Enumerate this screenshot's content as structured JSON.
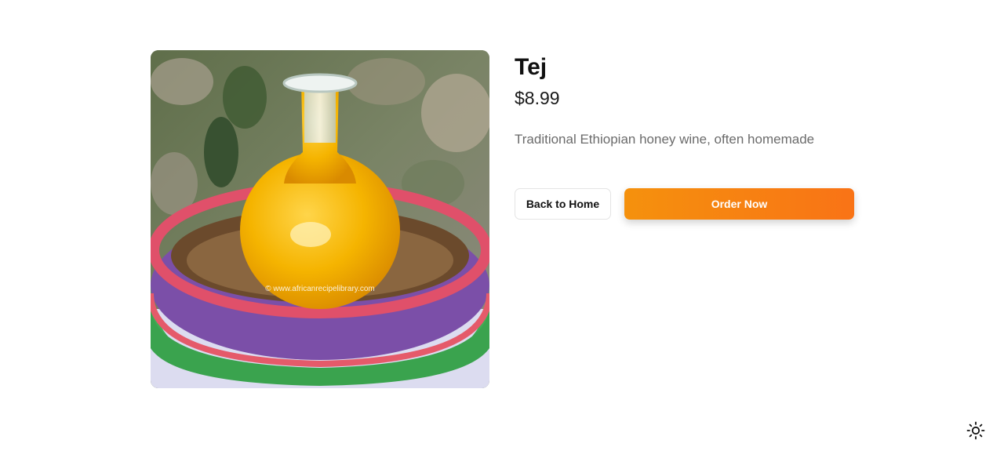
{
  "product": {
    "name": "Tej",
    "price": "$8.99",
    "description": "Traditional Ethiopian honey wine, often homemade",
    "image_alt": "Tej honey wine in a glass bottle inside a woven basket",
    "image_watermark": "© www.africanrecipelibrary.com"
  },
  "actions": {
    "back_label": "Back to Home",
    "order_label": "Order Now"
  },
  "theme_toggle": {
    "icon": "sun-icon"
  },
  "colors": {
    "accent_start": "#f5910d",
    "accent_end": "#f97316",
    "text_primary": "#111111",
    "text_muted": "#6b6b6b"
  }
}
